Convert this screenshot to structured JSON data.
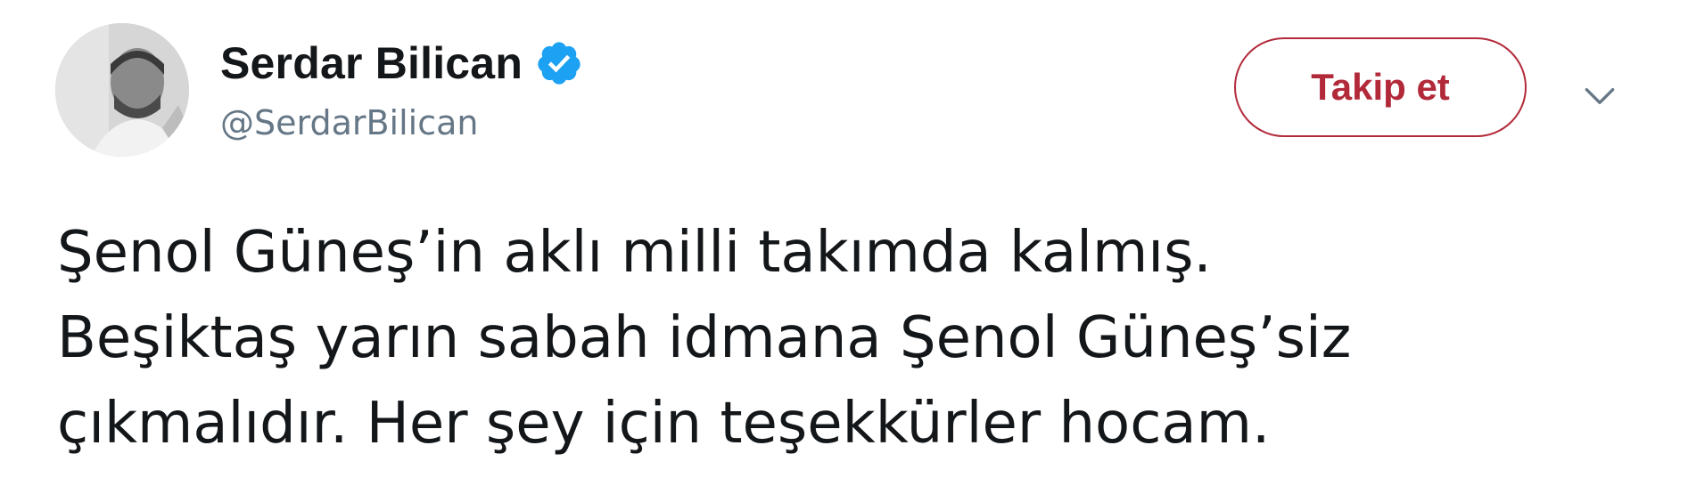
{
  "tweet": {
    "author": {
      "display_name": "Serdar Bilican",
      "handle": "@SerdarBilican",
      "verified": true
    },
    "follow_button_label": "Takip et",
    "text_lines": [
      "Şenol Güneş’in aklı milli takımda kalmış.",
      "Beşiktaş yarın sabah idmana Şenol Güneş’siz",
      "çıkmalıdır. Her şey için teşekkürler hocam."
    ]
  },
  "icons": {
    "verified": "verified-badge-icon",
    "menu": "chevron-down-icon"
  },
  "colors": {
    "follow_accent": "#b22a3a",
    "verified_blue": "#1da1f2",
    "handle_gray": "#657786",
    "text": "#14171a"
  }
}
